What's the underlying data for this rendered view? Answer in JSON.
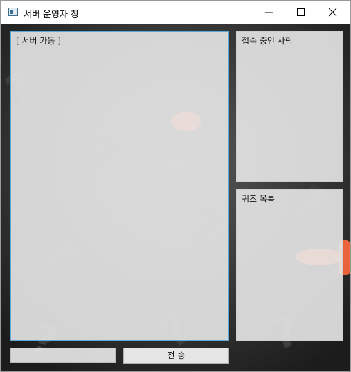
{
  "window": {
    "title": "서버 운영자 창"
  },
  "controls": {
    "minimize_icon": "minimize-icon",
    "maximize_icon": "maximize-icon",
    "close_icon": "close-icon"
  },
  "log_panel": {
    "text": "[ 서버 가동 ]"
  },
  "users_panel": {
    "title": "접속 중인 사람",
    "divider": "------------"
  },
  "quiz_panel": {
    "title": "퀴즈 목록",
    "divider": "--------"
  },
  "message_input": {
    "value": "",
    "placeholder": ""
  },
  "send_button": {
    "label": "전 송"
  },
  "colors": {
    "panel_border_active": "#5aa9d6",
    "accent_marks": "#ff6a3d",
    "background_dark": "#2a2a2a"
  }
}
